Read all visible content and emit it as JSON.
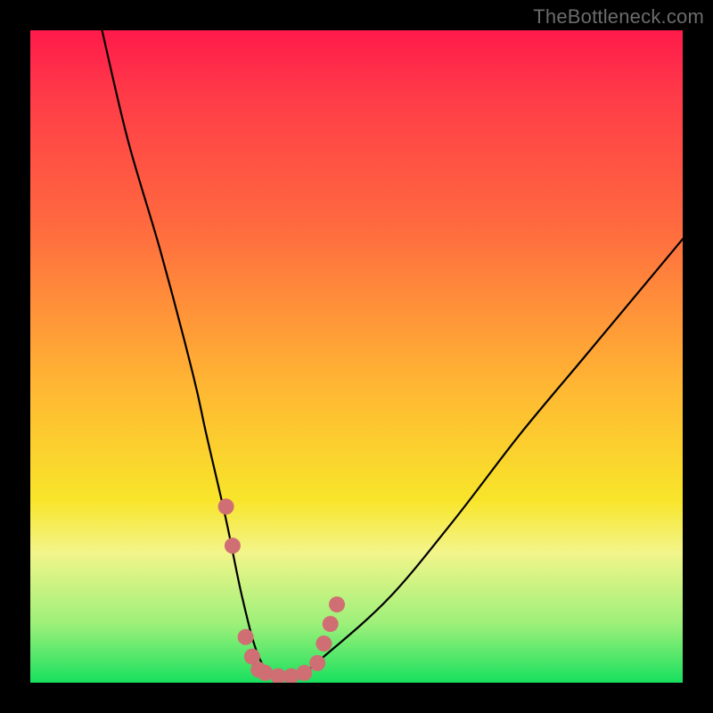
{
  "watermark": "TheBottleneck.com",
  "axes": {
    "x_range_percent": [
      0,
      100
    ],
    "y_range_bottleneck_percent": [
      0,
      100
    ]
  },
  "chart_data": {
    "type": "line",
    "title": "",
    "xlabel": "",
    "ylabel": "",
    "xlim_percent": [
      0,
      100
    ],
    "ylim_percent": [
      0,
      100
    ],
    "series": [
      {
        "name": "bottleneck-curve",
        "x_percent": [
          11,
          15,
          20,
          25,
          27,
          30,
          32.5,
          35,
          38,
          40,
          45,
          55,
          65,
          75,
          85,
          95,
          100
        ],
        "y_percent": [
          100,
          83,
          66,
          47,
          38,
          25,
          13,
          4,
          0,
          0,
          4,
          13,
          25,
          38,
          50,
          62,
          68
        ]
      }
    ],
    "markers": {
      "name": "sweet-spot-markers",
      "color": "#cf6f73",
      "points_xy_percent": [
        [
          30,
          27
        ],
        [
          31,
          21
        ],
        [
          33,
          7
        ],
        [
          34,
          4
        ],
        [
          35,
          2
        ],
        [
          36,
          1.5
        ],
        [
          38,
          1
        ],
        [
          40,
          1
        ],
        [
          42,
          1.5
        ],
        [
          44,
          3
        ],
        [
          45,
          6
        ],
        [
          46,
          9
        ],
        [
          47,
          12
        ]
      ]
    }
  }
}
